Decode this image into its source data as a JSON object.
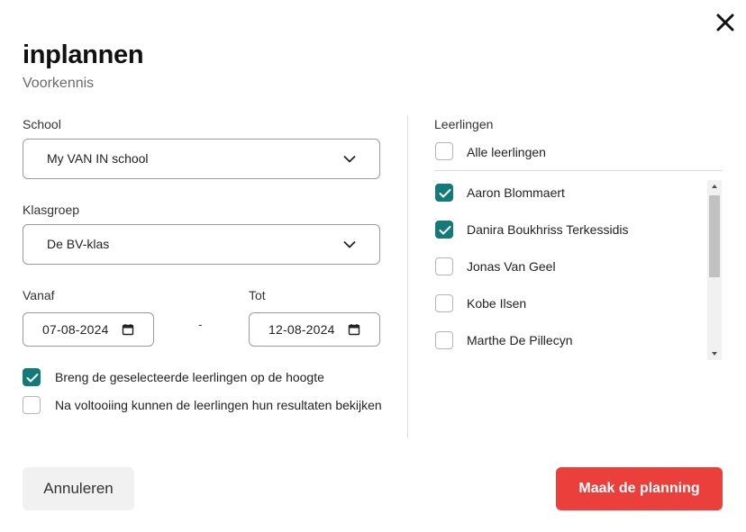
{
  "dialog": {
    "title": "inplannen",
    "subtitle": "Voorkennis",
    "close_icon": "close-icon"
  },
  "form": {
    "school": {
      "label": "School",
      "value": "My VAN IN school"
    },
    "klasgroep": {
      "label": "Klasgroep",
      "value": "De BV-klas"
    },
    "vanaf": {
      "label": "Vanaf",
      "value": "07-08-2024"
    },
    "tot": {
      "label": "Tot",
      "value": "12-08-2024"
    },
    "separator": "-",
    "options": [
      {
        "label": "Breng de geselecteerde leerlingen op de hoogte",
        "checked": true
      },
      {
        "label": "Na voltooiing kunnen de leerlingen hun resultaten bekijken",
        "checked": false
      }
    ]
  },
  "students": {
    "label": "Leerlingen",
    "select_all": {
      "label": "Alle leerlingen",
      "checked": false
    },
    "items": [
      {
        "name": "Aaron Blommaert",
        "checked": true
      },
      {
        "name": "Danira Boukhriss Terkessidis",
        "checked": true
      },
      {
        "name": "Jonas Van Geel",
        "checked": false
      },
      {
        "name": "Kobe Ilsen",
        "checked": false
      },
      {
        "name": "Marthe De Pillecyn",
        "checked": false
      }
    ]
  },
  "actions": {
    "cancel_label": "Annuleren",
    "submit_label": "Maak de planning"
  },
  "colors": {
    "accent_teal": "#137a7a",
    "primary_red": "#ea3f3a"
  }
}
